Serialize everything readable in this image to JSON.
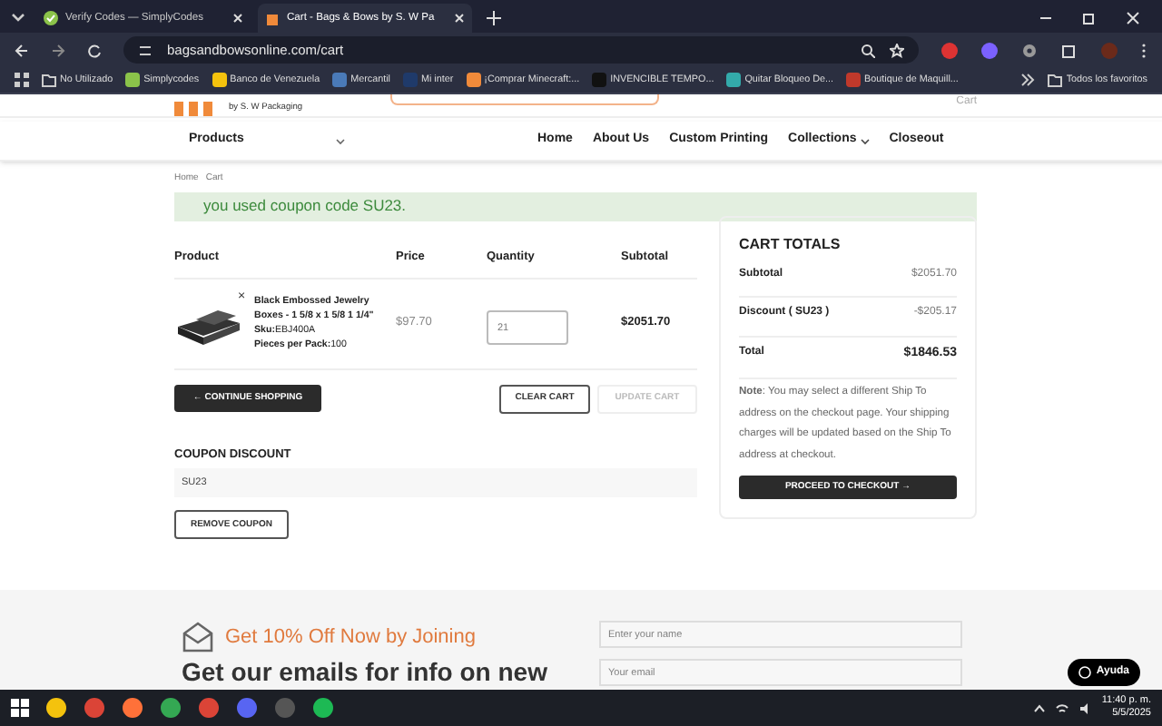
{
  "browser": {
    "tabs": [
      {
        "title": "Verify Codes — SimplyCodes",
        "selected": false
      },
      {
        "title": "Cart - Bags & Bows by S. W Pa",
        "selected": true
      }
    ],
    "url": "bagsandbowsonline.com/cart",
    "bookmarks": [
      "No Utilizado",
      "Simplycodes",
      "Banco de Venezuela",
      "Mercantil",
      "Mi inter",
      "¡Comprar Minecraft:...",
      "INVENCIBLE TEMPO...",
      "Quitar Bloqueo De...",
      "Boutique de Maquill..."
    ],
    "all_bookmarks": "Todos los favoritos"
  },
  "header": {
    "logo_tagline": "by S. W Packaging",
    "cart_label": "Cart",
    "products_menu": "Products",
    "nav": [
      {
        "label": "Home",
        "dropdown": false
      },
      {
        "label": "About Us",
        "dropdown": false
      },
      {
        "label": "Custom Printing",
        "dropdown": false
      },
      {
        "label": "Collections",
        "dropdown": true
      },
      {
        "label": "Closeout",
        "dropdown": false
      }
    ]
  },
  "breadcrumb": [
    "Home",
    "Cart"
  ],
  "notice": "you used coupon code SU23.",
  "cart": {
    "columns": [
      "Product",
      "Price",
      "Quantity",
      "Subtotal"
    ],
    "rows": [
      {
        "name": "Black Embossed Jewelry Boxes - 1 5/8 x 1 5/8 1 1/4\"",
        "sku_label": "Sku:",
        "sku": "EBJ400A",
        "pack_label": "Pieces per Pack:",
        "pack": "100",
        "price": "$97.70",
        "quantity": "21",
        "subtotal": "$2051.70",
        "remove": "×"
      }
    ],
    "continue": "← CONTINUE SHOPPING",
    "clear": "CLEAR CART",
    "update": {
      "label": "UPDATE CART",
      "disabled": true
    }
  },
  "coupon": {
    "heading": "COUPON DISCOUNT",
    "value": "SU23",
    "remove": "REMOVE COUPON"
  },
  "totals": {
    "title": "CART TOTALS",
    "lines": [
      {
        "label": "Subtotal",
        "value": "$2051.70",
        "kind": "plain"
      },
      {
        "label": "Discount ( SU23 )",
        "value": "-$205.17",
        "kind": "plain"
      },
      {
        "label": "Total",
        "value": "$1846.53",
        "kind": "total"
      }
    ],
    "note": "**Note**: You may select a different Ship To address on the checkout page. Your shipping charges will be updated based on the Ship To address at checkout.",
    "checkout": "PROCEED TO CHECKOUT →"
  },
  "footer": {
    "offer": "Get 10% Off Now by Joining",
    "headline": "Get our emails for info on new",
    "name_placeholder": "Enter your name",
    "email_placeholder": "Your email",
    "help": "Ayuda"
  },
  "taskbar": {
    "time": "11:40 p. m.",
    "date": "5/5/2025"
  }
}
